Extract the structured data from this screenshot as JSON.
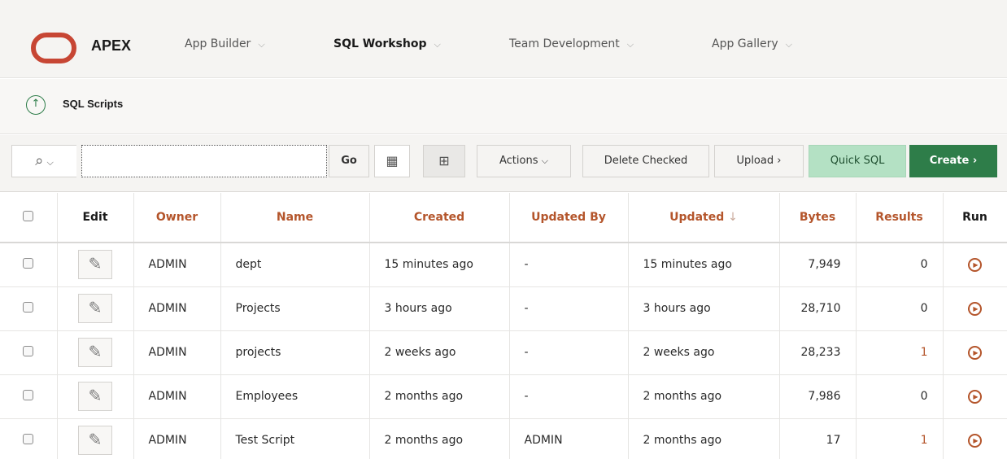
{
  "header": {
    "brand": "APEX",
    "nav": [
      {
        "label": "App Builder",
        "chevron": "⌵",
        "active": false
      },
      {
        "label": "SQL Workshop",
        "chevron": "⌵",
        "active": true
      },
      {
        "label": "Team Development",
        "chevron": "⌵",
        "active": false
      },
      {
        "label": "App Gallery",
        "chevron": "⌵",
        "active": false
      }
    ]
  },
  "breadcrumb": {
    "up_icon": "↑",
    "title": "SQL Scripts"
  },
  "toolbar": {
    "search_icon": "⌕",
    "search_chevron": "⌵",
    "search_value": "",
    "go_label": "Go",
    "grid_icon": "▦",
    "report_icon": "⊞",
    "actions_label": "Actions",
    "actions_chevron": "⌵",
    "delete_checked_label": "Delete Checked",
    "upload_label": "Upload",
    "upload_arrow": "›",
    "quick_sql_label": "Quick SQL",
    "create_label": "Create",
    "create_arrow": "›"
  },
  "table": {
    "columns": {
      "edit": "Edit",
      "owner": "Owner",
      "name": "Name",
      "created": "Created",
      "updated_by": "Updated By",
      "updated": "Updated",
      "sort_icon": "↓",
      "bytes": "Bytes",
      "results": "Results",
      "run": "Run"
    },
    "rows": [
      {
        "owner": "ADMIN",
        "name": "dept",
        "created": "15 minutes ago",
        "updated_by": "-",
        "updated": "15 minutes ago",
        "bytes": "7,949",
        "results": "0"
      },
      {
        "owner": "ADMIN",
        "name": "Projects",
        "created": "3 hours ago",
        "updated_by": "-",
        "updated": "3 hours ago",
        "bytes": "28,710",
        "results": "0"
      },
      {
        "owner": "ADMIN",
        "name": "projects",
        "created": "2 weeks ago",
        "updated_by": "-",
        "updated": "2 weeks ago",
        "bytes": "28,233",
        "results": "1"
      },
      {
        "owner": "ADMIN",
        "name": "Employees",
        "created": "2 months ago",
        "updated_by": "-",
        "updated": "2 months ago",
        "bytes": "7,986",
        "results": "0"
      },
      {
        "owner": "ADMIN",
        "name": "Test Script",
        "created": "2 months ago",
        "updated_by": "ADMIN",
        "updated": "2 months ago",
        "bytes": "17",
        "results": "1"
      }
    ],
    "edit_icon": "pencil-icon",
    "run_icon": "play-circle-icon"
  },
  "colors": {
    "accent": "#c74634",
    "primary": "#2e7d49",
    "link": "#b4552b",
    "quick_sql": "#b4e1c4"
  }
}
